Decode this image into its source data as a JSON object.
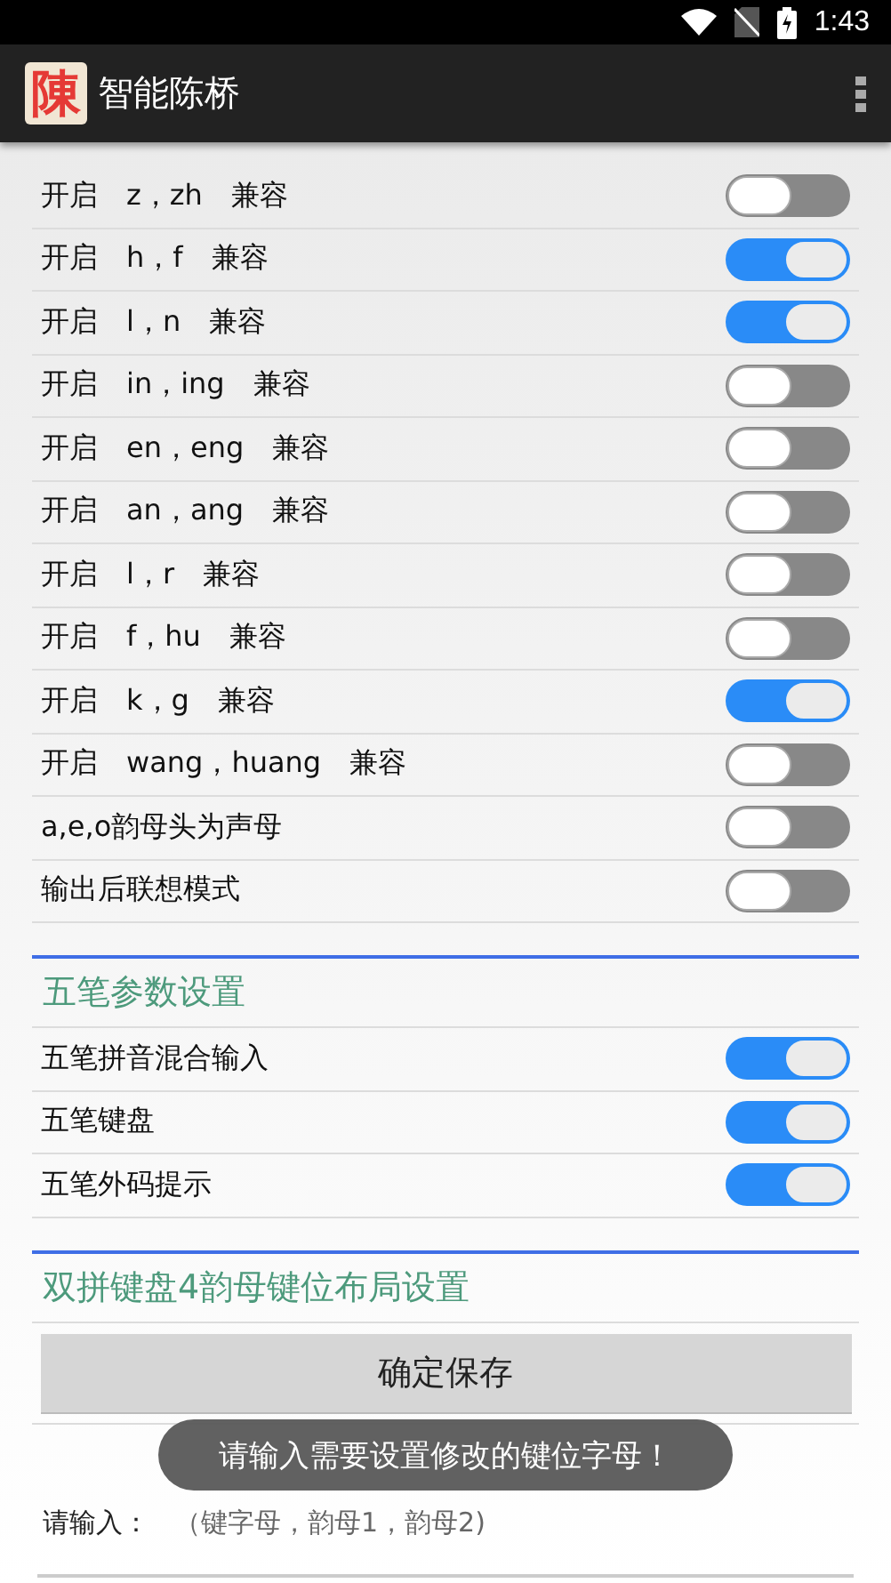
{
  "status_bar": {
    "time": "1:43"
  },
  "app_bar": {
    "logo": "陳",
    "title": "智能陈桥"
  },
  "pinyin_options": [
    {
      "label": "开启　z，zh　兼容",
      "on": false
    },
    {
      "label": "开启　h，f　兼容",
      "on": true
    },
    {
      "label": "开启　l，n　兼容",
      "on": true
    },
    {
      "label": "开启　in，ing　兼容",
      "on": false
    },
    {
      "label": "开启　en，eng　兼容",
      "on": false
    },
    {
      "label": "开启　an，ang　兼容",
      "on": false
    },
    {
      "label": "开启　l，r　兼容",
      "on": false
    },
    {
      "label": "开启　f，hu　兼容",
      "on": false
    },
    {
      "label": "开启　k，g　兼容",
      "on": true
    },
    {
      "label": "开启　wang，huang　兼容",
      "on": false
    },
    {
      "label": "a,e,o韵母头为声母",
      "on": false
    },
    {
      "label": "输出后联想模式",
      "on": false
    }
  ],
  "wubi_section": {
    "title": "五笔参数设置",
    "options": [
      {
        "label": "五笔拼音混合输入",
        "on": true
      },
      {
        "label": "五笔键盘",
        "on": true
      },
      {
        "label": "五笔外码提示",
        "on": true
      }
    ]
  },
  "layout_section": {
    "title": "双拼键盘4韵母键位布局设置",
    "save_button": "确定保存",
    "input_label": "请输入：",
    "placeholder": "（键字母，韵母1，韵母2)"
  },
  "toast": "请输入需要设置修改的键位字母！"
}
